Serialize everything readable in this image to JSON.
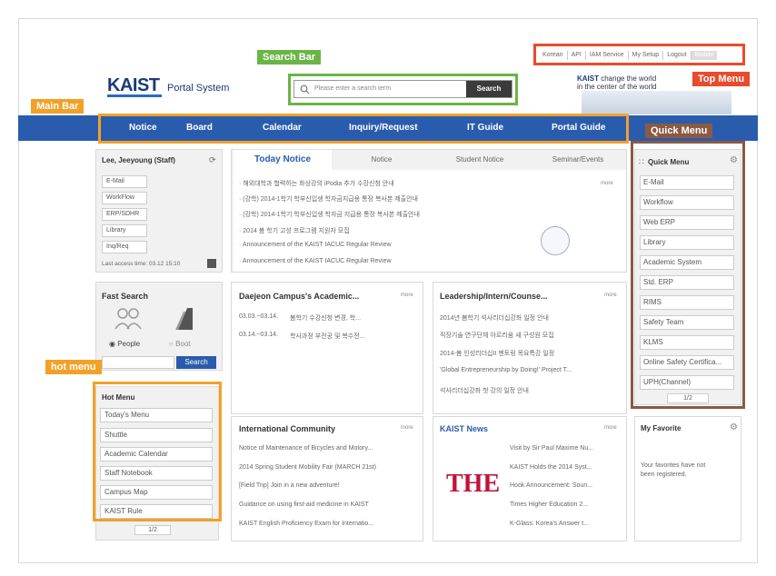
{
  "annotations": {
    "search_bar": "Search Bar",
    "top_menu": "Top Menu",
    "main_bar": "Main Bar",
    "quick_menu": "Quick Menu",
    "hot_menu": "hot menu"
  },
  "top_menu": [
    "Korean",
    "API",
    "IAM Service",
    "My Setup",
    "Logout",
    "Mobile"
  ],
  "logo": {
    "name": "KAIST",
    "sub": "Portal System"
  },
  "search": {
    "placeholder": "Please enter a search term",
    "button": "Search"
  },
  "slogan": {
    "brand": "KAIST",
    "line1": " change the world",
    "line2": "in the center of the world"
  },
  "main_bar": [
    "Notice",
    "Board",
    "Calendar",
    "Inquiry/Request",
    "IT Guide",
    "Portal Guide"
  ],
  "profile": {
    "name": "Lee, Jeeyoung (Staff)",
    "links": [
      "E-Mail",
      "WorkFlow",
      "ERP/SDHR",
      "Library",
      "Inq/Req"
    ],
    "last_access": "Last access time: 03.12 15:10"
  },
  "fast_search": {
    "title": "Fast Search",
    "opt1": "People",
    "opt2": "Boot",
    "button": "Search"
  },
  "hot_menu": {
    "title": "Hot Menu",
    "items": [
      "Today's Menu",
      "Shuttle",
      "Academic Calendar",
      "Staff Notebook",
      "Campus Map",
      "KAIST Rule"
    ],
    "pager": "1/2"
  },
  "notice": {
    "tabs": [
      "Today Notice",
      "Notice",
      "Student Notice",
      "Seminar/Events"
    ],
    "more": "more",
    "items": [
      "해외대학과 협력하는 화상강의 iPodia 추가 수강신청 안내",
      "(강학) 2014-1학기 학부신입생 학자금지급용 통장 복사본 제출안내",
      "(강학) 2014-1학기 학부신입생 학자금 지급용 통장 복사본 제출안내",
      "2014 봄 학기 고성 프로그램 지원자 모집",
      "Announcement of the KAIST IACUC Regular Review",
      "Announcement of the KAIST IACUC Regular Review"
    ]
  },
  "daejeon": {
    "title": "Daejeon Campus's Academic...",
    "more": "more",
    "rows": [
      {
        "date": "03.03.~03.14.",
        "text": "봄학기 수강신청 변경, 학..."
      },
      {
        "date": "03.14.~03.14.",
        "text": "학사과정 부전공 및 복수전..."
      }
    ]
  },
  "leadership": {
    "title": "Leadership/Intern/Counse...",
    "more": "more",
    "items": [
      "2014년 봄학기 석사리더십강좌 일정 안내",
      "직장기술 연구단체 아르리움 새 구성원 모집",
      "2014-봄 인성리더십II 멘토링 목요특강 일정",
      "'Global Entrepreneurship by Doing!' Project T...",
      "석사리더십강좌 첫 강의 일정 안내"
    ]
  },
  "intl": {
    "title": "International Community",
    "more": "more",
    "items": [
      "Notice of Maintenance of Bicycles and Motory...",
      "2014 Spring Student Mobility Fair (MARCH 21st)",
      "[Field Trip] Join in a new adventure!",
      "Guidance on using first-aid medicine in KAIST",
      "KAIST English Proficiency Exam for Internatio..."
    ]
  },
  "news": {
    "title": "KAIST News",
    "more": "more",
    "logo": "THE",
    "items": [
      "Visit by Sir Paul Maxime Nu...",
      "KAIST Holds the 2014 Syst...",
      "Hook Announcement: Soun...",
      "Times Higher Education 2...",
      "K-Glass: Korea's Answer t..."
    ]
  },
  "quick_menu": {
    "title": "Quick Menu",
    "items": [
      "E-Mail",
      "Workflow",
      "Web ERP",
      "Library",
      "Academic System",
      "Std. ERP",
      "RIMS",
      "Safety Team",
      "KLMS",
      "Online Safety Certifica...",
      "UPH(Channel)"
    ],
    "pager": "1/2"
  },
  "favorite": {
    "title": "My Favorite",
    "text1": "Your favorites have not",
    "text2": "been registered."
  },
  "colors": {
    "brand": "#2a5cad",
    "ann_green": "#6ab546",
    "ann_red": "#e74c2d",
    "ann_orange": "#f2a128",
    "ann_brown": "#8a5a44"
  }
}
